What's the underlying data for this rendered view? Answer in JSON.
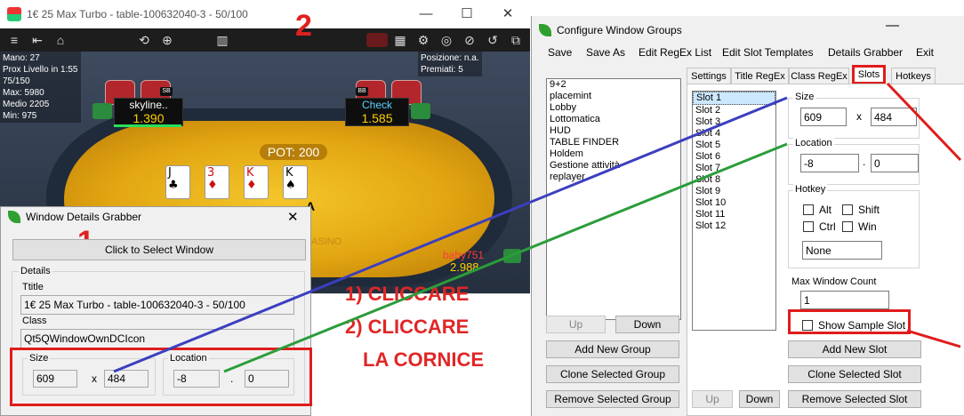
{
  "poker": {
    "title": "1€ 25 Max Turbo - table-100632040-3 - 50/100",
    "minimize": "—",
    "maximize": "☐",
    "close": "✕",
    "toolbar_left": [
      "≡",
      "⇤",
      "⌂",
      "⟲",
      "⊕",
      "▥"
    ],
    "toolbar_right": [
      "▦",
      "⚙",
      "◎",
      "⊘",
      "↺",
      "⧉",
      "▣"
    ],
    "info_left": [
      "Mano: 27",
      "Prox Livello in 1:55",
      "75/150",
      "Max: 5980",
      "Medio 2205",
      "Min: 975"
    ],
    "info_right": [
      "Posizione: n.a.",
      "Premiati: 5"
    ],
    "player1": {
      "name": "skyline..",
      "chips": "1.390",
      "badge": "SB"
    },
    "player2": {
      "name": "Check",
      "chips": "1.585",
      "badge": "BB"
    },
    "player3": {
      "name": "baby751",
      "chips": "2.988"
    },
    "pot": "POT: 200",
    "cards": [
      {
        "rank": "J",
        "suit": "♣",
        "color": "#000000"
      },
      {
        "rank": "3",
        "suit": "♦",
        "color": "#cc1111"
      },
      {
        "rank": "K",
        "suit": "♦",
        "color": "#cc1111"
      },
      {
        "rank": "K",
        "suit": "♠",
        "color": "#000000"
      }
    ],
    "hidden_card": "A",
    "logo_fragment": "ASINO"
  },
  "annotations": {
    "num1": "1",
    "num2": "2",
    "line1": "1) CLICCARE",
    "line2": "2) CLICCARE",
    "line3": "LA CORNICE",
    "blue_line": "#3b3fbf",
    "green_line": "#2a9d3a",
    "red": "#e01c1c"
  },
  "grabber": {
    "title": "Window Details Grabber",
    "close": "✕",
    "select_button": "Click to Select Window",
    "details_label": "Details",
    "title_label": "Ttitle",
    "title_value": "1€ 25 Max Turbo - table-100632040-3 - 50/100",
    "class_label": "Class",
    "class_value": "Qt5QWindowOwnDCIcon",
    "size_label": "Size",
    "size_w": "609",
    "size_x": "x",
    "size_h": "484",
    "location_label": "Location",
    "loc_x": "-8",
    "loc_sep": ".",
    "loc_y": "0"
  },
  "cfg": {
    "title": "Configure Window Groups",
    "minimize": "—",
    "menu": [
      "Save",
      "Save As",
      "Edit RegEx List",
      "Edit Slot Templates",
      "Details Grabber",
      "Exit"
    ],
    "groups": [
      "9+2",
      "placemint",
      "Lobby",
      "Lottomatica",
      "HUD",
      "TABLE FINDER",
      "Holdem",
      "Gestione attività",
      "replayer"
    ],
    "up": "Up",
    "down": "Down",
    "add_group": "Add New Group",
    "clone_group": "Clone Selected Group",
    "remove_group": "Remove Selected Group",
    "tabs": [
      "Settings",
      "Title RegEx",
      "Class RegEx",
      "Slots",
      "Hotkeys"
    ],
    "slots": [
      "Slot 1",
      "Slot 2",
      "Slot 3",
      "Slot 4",
      "Slot 5",
      "Slot 6",
      "Slot 7",
      "Slot 8",
      "Slot 9",
      "Slot 10",
      "Slot 11",
      "Slot 12"
    ],
    "size_label": "Size",
    "size_w": "609",
    "size_x": "x",
    "size_h": "484",
    "location_label": "Location",
    "loc_x": "-8",
    "loc_sep": ".",
    "loc_y": "0",
    "hotkey_label": "Hotkey",
    "alt": "Alt",
    "shift": "Shift",
    "ctrl": "Ctrl",
    "win": "Win",
    "hotkey_value": "None",
    "max_count_label": "Max Window Count",
    "max_count_value": "1",
    "show_sample": "Show Sample Slot",
    "add_slot": "Add New Slot",
    "clone_slot": "Clone Selected Slot",
    "remove_slot": "Remove Selected Slot",
    "slot_up": "Up",
    "slot_down": "Down"
  }
}
